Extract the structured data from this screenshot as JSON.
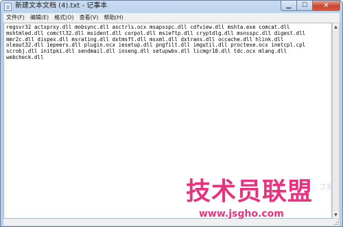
{
  "window": {
    "title": "新建文本文档 (4).txt - 记事本",
    "controls": {
      "minimize_icon": "minimize-icon",
      "maximize_icon": "maximize-icon",
      "close_icon": "close-icon",
      "minimize_glyph": "▁",
      "maximize_glyph": "☐",
      "close_glyph": "✕"
    }
  },
  "menubar": {
    "items": [
      {
        "label": "文件(F)"
      },
      {
        "label": "编辑(E)"
      },
      {
        "label": "格式(O)"
      },
      {
        "label": "查看(V)"
      },
      {
        "label": "帮助(H)"
      }
    ]
  },
  "editor": {
    "lines": [
      "regsvr32 actxprxy.dll mobsync.dll asctrls.ocx msapsspc.dll cdfview.dll mshta.exe comcat.dll",
      "mshtmled.dll comctl32.dll msident.dll corpol.dll msieftp.dll cryptdlg.dll msnsspc.dll digest.dll",
      "mmr2c.dll dispex.dll msrating.dll dxtmsft.dll msxml.dll dxtrans.dll occache.dll hlink.dll",
      "oleaut32.dll iepeers.dll plugin.ocx iesetup.dll pngfilt.dll imgutil.dll proctexe.ocx inetcpl.cpl",
      "scrobj.dll initpki.dll sendmail.dll inseng.dll setupwbv.dll licmgr10.dll tdc.ocx mlang.dll",
      "webcheck.dll"
    ]
  },
  "scrollbar": {
    "up_glyph": "▲",
    "down_glyph": "▼"
  },
  "watermark": {
    "logo_text": "技术员联盟",
    "url": "www.jsgho.com",
    "side_text": "之家",
    "color": "#e6337f"
  }
}
